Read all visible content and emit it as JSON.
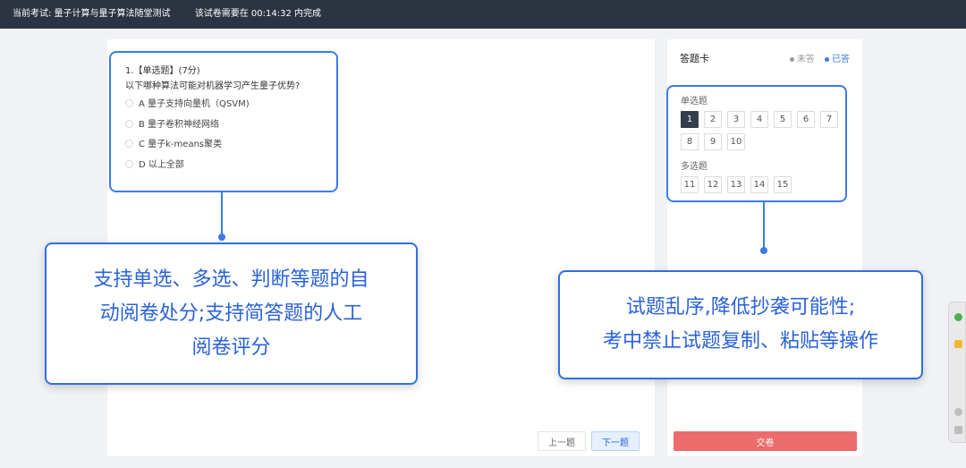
{
  "topbar": {
    "exam_title": "当前考试: 量子计算与量子算法随堂测试",
    "timer": "该试卷需要在 00:14:32 内完成"
  },
  "question": {
    "title": "1.【单选题】(7分)",
    "text": "以下哪种算法可能对机器学习产生量子优势?",
    "options": [
      {
        "label": "A  量子支持向量机（QSVM)"
      },
      {
        "label": "B  量子卷积神经网络"
      },
      {
        "label": "C  量子k-means聚类"
      },
      {
        "label": "D  以上全部"
      }
    ]
  },
  "answer_card": {
    "title": "答题卡",
    "legend_unanswered": "未答",
    "legend_answered": "已答",
    "single_label": "单选题",
    "single_numbers": [
      "1",
      "2",
      "3",
      "4",
      "5",
      "6",
      "7",
      "8",
      "9",
      "10"
    ],
    "multi_label": "多选题",
    "multi_numbers": [
      "11",
      "12",
      "13",
      "14",
      "15"
    ],
    "colors": {
      "answered": "#3c7be8",
      "unanswered": "#999999",
      "current": "#333d4d"
    }
  },
  "callout_left": {
    "line1": "支持单选、多选、判断等题的自",
    "line2": "动阅卷处分;支持简答题的人工",
    "line3": "阅卷评分"
  },
  "callout_right": {
    "line1": "试题乱序,降低抄袭可能性;",
    "line2": "考中禁止试题复制、粘贴等操作"
  },
  "nav": {
    "prev_label": "上一题",
    "next_label": "下一题",
    "submit_label": "交卷"
  },
  "theme": {
    "accent": "#3c7be8",
    "submit": "#ec6b6b",
    "topbar": "#2c3442"
  }
}
